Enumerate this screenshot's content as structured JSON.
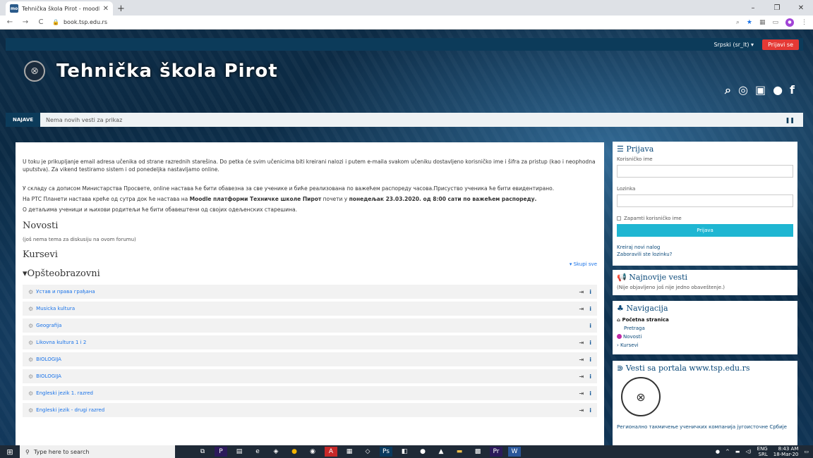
{
  "browser": {
    "tab_title": "Tehnička škola Pirot - moodle",
    "tab_favicon": "mo",
    "url": "book.tsp.edu.rs",
    "icons": [
      "back-icon",
      "forward-icon",
      "reload-icon",
      "lock-icon",
      "zoom-icon",
      "star-icon",
      "extension-icon",
      "profile-icon"
    ]
  },
  "topnav": {
    "language": "Srpski (sr_lt) ▾",
    "login": "Prijavi se"
  },
  "banner": {
    "title": "Tehnička škola Pirot",
    "social": [
      "search-icon",
      "instagram-icon",
      "youtube-icon",
      "globe-icon",
      "facebook-icon"
    ]
  },
  "ticker": {
    "label": "NAJAVE",
    "message": "Nema novih vesti za prikaz"
  },
  "main": {
    "para1": "U toku je prikupljanje email adresa učenika od strane razrednih starešina. Do petka će svim učenicima biti kreirani nalozi i putem e-maila svakom učeniku dostavljeno korisničko ime i šifra za pristup (kao i neophodna uputstva). Za vikend testiramo sistem i od ponedeljka nastavljamo online.",
    "para2": "У складу са дописом Министарства Просвете, online настава ће бити обавезна за све ученике и биће реализована по важећем распореду часова.Присуство ученика ће бити евидентирано.",
    "para3_a": "На РТС Планети настава креће од сутра док ће настава на ",
    "para3_b": "Moodle платформи Техничке школе Пирот",
    "para3_c": " почети у ",
    "para3_d": "понедељак 23.03.2020. од 8:00 сати по важећем распореду.",
    "para4": "О детаљима ученици и њихови родитељи ће бити обавештени од својих одељенских старешина.",
    "news_title": "Novosti",
    "news_empty": "(još nema tema za diskusiju na ovom forumu)",
    "courses_title": "Kursevi",
    "collapse_all": "▾ Skupi sve",
    "category": "▾Opšteobrazovni",
    "courses": [
      {
        "name": "Устав и права грађана",
        "enrol": true
      },
      {
        "name": "Musicka kultura",
        "enrol": true
      },
      {
        "name": "Geografija",
        "enrol": false
      },
      {
        "name": "Likovna kultura 1 i 2",
        "enrol": true
      },
      {
        "name": "BIOLOGIJA",
        "enrol": true
      },
      {
        "name": "BIOLOGIJA",
        "enrol": true
      },
      {
        "name": "Engleski jezik 1. razred",
        "enrol": true
      },
      {
        "name": "Engleski jezik - drugi razred",
        "enrol": true
      }
    ]
  },
  "sidebar": {
    "login": {
      "title": "Prijava",
      "username_label": "Korisničko ime",
      "password_label": "Lozinka",
      "remember": "Zapamti korisničko ime",
      "button": "Prijava",
      "create": "Kreiraj novi nalog",
      "forgot": "Zaboravili ste lozinku?"
    },
    "news": {
      "title": "Najnovije vesti",
      "empty": "(Nije objavljeno još nije jedno obaveštenje.)"
    },
    "navigation": {
      "title": "Navigacija",
      "home": "Početna stranica",
      "search": "Pretraga",
      "news": "Novosti",
      "courses": "Kursevi"
    },
    "portal": {
      "title": "Vesti sa portala www.tsp.edu.rs",
      "item": "Регионално такмичење ученичких компанија југоисточне Србије"
    }
  },
  "taskbar": {
    "search_placeholder": "Type here to search",
    "lang": "ENG",
    "lang2": "SRL",
    "time": "8:43 AM",
    "date": "18-Mar-20"
  }
}
